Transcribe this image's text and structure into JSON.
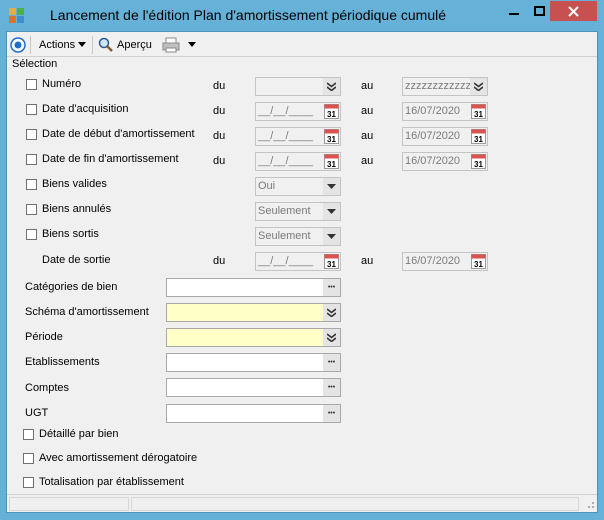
{
  "window": {
    "title": "Lancement de l'édition Plan d'amortissement périodique cumulé"
  },
  "toolbar": {
    "actions_label": "Actions",
    "preview_label": "Aperçu"
  },
  "selection": {
    "group_label": "Sélection",
    "du": "du",
    "au": "au",
    "numero": {
      "label": "Numéro",
      "from": "",
      "to": "zzzzzzzzzzzz"
    },
    "acquisition": {
      "label": "Date d'acquisition",
      "from": "__/__/____",
      "to": "16/07/2020"
    },
    "debut": {
      "label": "Date de début d'amortissement",
      "from": "__/__/____",
      "to": "16/07/2020"
    },
    "fin": {
      "label": "Date de fin d'amortissement",
      "from": "__/__/____",
      "to": "16/07/2020"
    },
    "valides": {
      "label": "Biens valides",
      "value": "Oui"
    },
    "annules": {
      "label": "Biens annulés",
      "value": "Seulement"
    },
    "sortis": {
      "label": "Biens sortis",
      "value": "Seulement"
    },
    "date_sortie": {
      "label": "Date de sortie",
      "from": "__/__/____",
      "to": "16/07/2020"
    }
  },
  "filters": {
    "categories": "Catégories de bien",
    "schema": "Schéma d'amortissement",
    "periode": "Période",
    "etablissements": "Etablissements",
    "comptes": "Comptes",
    "ugt": "UGT"
  },
  "options": {
    "detail": "Détaillé par bien",
    "derogatoire": "Avec amortissement dérogatoire",
    "totalisation": "Totalisation par établissement"
  },
  "calendar_day": "31",
  "ellipsis": "•••"
}
